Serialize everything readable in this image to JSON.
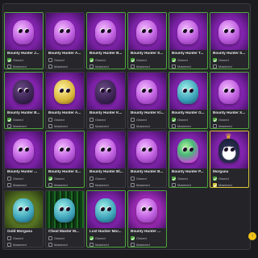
{
  "labels": {
    "owned": "Owned",
    "mastered": "Mastered"
  },
  "scroll_top_icon": "arrow-up-icon",
  "cards": [
    {
      "name": "Bounty Hunter J...",
      "owned": true,
      "mastered": false,
      "art": "purple",
      "creature": "pink"
    },
    {
      "name": "Bounty Hunter A...",
      "owned": false,
      "mastered": false,
      "art": "purple",
      "creature": "pink"
    },
    {
      "name": "Bounty Hunter B...",
      "owned": true,
      "mastered": false,
      "art": "purple",
      "creature": "pink"
    },
    {
      "name": "Bounty Hunter S...",
      "owned": true,
      "mastered": false,
      "art": "purple",
      "creature": "pink"
    },
    {
      "name": "Bounty Hunter T...",
      "owned": true,
      "mastered": false,
      "art": "purple",
      "creature": "pink"
    },
    {
      "name": "Bounty Hunter S...",
      "owned": true,
      "mastered": false,
      "art": "purple",
      "creature": "pink"
    },
    {
      "name": "Bounty Hunter B...",
      "owned": true,
      "mastered": false,
      "art": "purple",
      "creature": "dark"
    },
    {
      "name": "Bounty Hunter A...",
      "owned": false,
      "mastered": false,
      "art": "purple",
      "creature": "yellow"
    },
    {
      "name": "Bounty Hunter K...",
      "owned": false,
      "mastered": false,
      "art": "purple",
      "creature": "dark"
    },
    {
      "name": "Bounty Hunter Ki...",
      "owned": false,
      "mastered": false,
      "art": "purple",
      "creature": "pink"
    },
    {
      "name": "Bounty Hunter G...",
      "owned": true,
      "mastered": false,
      "art": "purple",
      "creature": "teal"
    },
    {
      "name": "Bounty Hunter X...",
      "owned": true,
      "mastered": false,
      "art": "purple",
      "creature": "pink"
    },
    {
      "name": "Bounty Hunter ...",
      "owned": false,
      "mastered": false,
      "art": "purple",
      "creature": "pink"
    },
    {
      "name": "Bounty Hunter S...",
      "owned": true,
      "mastered": false,
      "art": "purple",
      "creature": "pink"
    },
    {
      "name": "Bounty Hunter Bl...",
      "owned": false,
      "mastered": false,
      "art": "purple",
      "creature": "pink"
    },
    {
      "name": "Bounty Hunter B...",
      "owned": false,
      "mastered": false,
      "art": "purple",
      "creature": "pink"
    },
    {
      "name": "Bounty Hunter P...",
      "owned": true,
      "mastered": false,
      "art": "purple",
      "creature": "rainbow"
    },
    {
      "name": "Morgana",
      "owned": true,
      "mastered": true,
      "art": "purple",
      "creature": "penguin",
      "crown": true
    },
    {
      "name": "Gold Morgana",
      "owned": false,
      "mastered": false,
      "art": "gold",
      "creature": "teal"
    },
    {
      "name": "Cheat Master M...",
      "owned": false,
      "mastered": false,
      "art": "green",
      "creature": "teal"
    },
    {
      "name": "Lost Hacker Mor...",
      "owned": true,
      "mastered": false,
      "art": "purple",
      "creature": "teal"
    },
    {
      "name": "Bounty Hunter ...",
      "owned": true,
      "mastered": false,
      "art": "magenta",
      "creature": "pink"
    }
  ]
}
